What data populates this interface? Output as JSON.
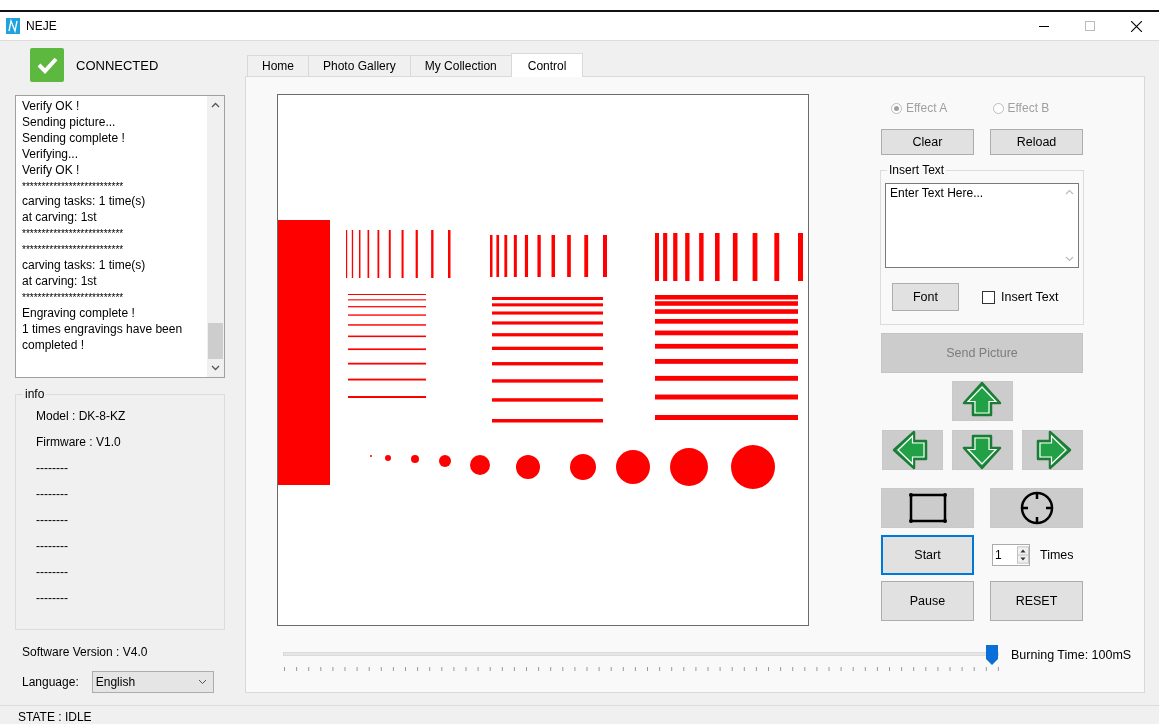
{
  "window": {
    "title": "NEJE"
  },
  "connection": {
    "label": "CONNECTED",
    "connected": true
  },
  "log": {
    "lines": [
      "Verify OK !",
      "Sending picture...",
      "Sending complete !",
      "Verifying...",
      "Verify OK !",
      "**************************",
      "carving tasks: 1 time(s)",
      "at carving: 1st",
      "**************************",
      "**************************",
      "carving tasks: 1 time(s)",
      "at carving: 1st",
      "**************************",
      "Engraving complete !",
      "1 times engravings have been completed !"
    ]
  },
  "info": {
    "title": "info",
    "lines": [
      "Model : DK-8-KZ",
      "Firmware : V1.0",
      "--------",
      "--------",
      "--------",
      "--------",
      "--------",
      "--------"
    ]
  },
  "software_version": "Software Version : V4.0",
  "language": {
    "label": "Language:",
    "value": "English"
  },
  "tabs": [
    {
      "label": "Home",
      "selected": false
    },
    {
      "label": "Photo Gallery",
      "selected": false
    },
    {
      "label": "My Collection",
      "selected": false
    },
    {
      "label": "Control",
      "selected": true
    }
  ],
  "control": {
    "effects": [
      {
        "label": "Effect A",
        "selected": true,
        "disabled": true
      },
      {
        "label": "Effect B",
        "selected": false,
        "disabled": true
      }
    ],
    "clear_button": "Clear",
    "reload_button": "Reload",
    "insert_text": {
      "title": "Insert Text",
      "placeholder": "Enter Text Here...",
      "font_button": "Font",
      "checkbox": {
        "label": "Insert Text",
        "checked": false
      }
    },
    "send_picture": {
      "label": "Send Picture",
      "disabled": true
    },
    "start": {
      "label": "Start",
      "focused": true
    },
    "times": {
      "value": "1",
      "label": "Times"
    },
    "pause_button": "Pause",
    "reset_button": "RESET",
    "burning_time": {
      "level": 0.99,
      "label": "Burning Time: 100mS"
    }
  },
  "status_bar": "STATE : IDLE"
}
